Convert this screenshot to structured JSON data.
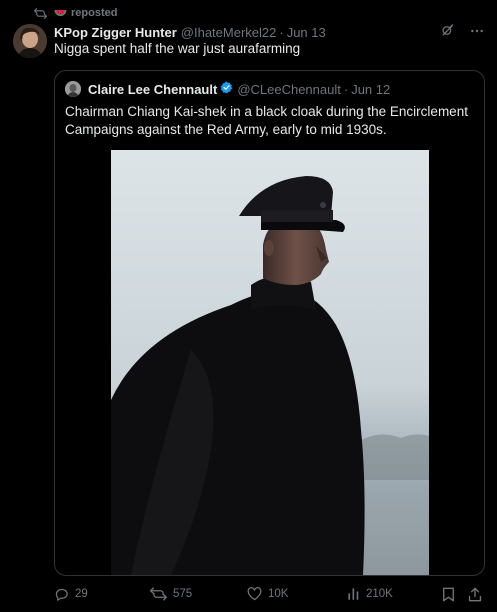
{
  "repost": {
    "label": "reposted"
  },
  "tweet": {
    "display_name": "KPop Zigger Hunter",
    "handle": "@IhateMerkel22",
    "separator": "·",
    "time": "Jun 13",
    "text": "Nigga spent half the war just aurafarming"
  },
  "quote": {
    "display_name": "Claire Lee Chennault",
    "handle": "@CLeeChennault",
    "separator": "·",
    "time": "Jun 12",
    "text": "Chairman Chiang Kai-shek in a black cloak during the Encirclement Campaigns against the Red Army, early to mid 1930s."
  },
  "actions": {
    "replies": "29",
    "reposts": "575",
    "likes": "10K",
    "views": "210K"
  },
  "colors": {
    "background": "#000000",
    "text": "#e7e9ea",
    "muted": "#71767b",
    "border": "#2f3336",
    "verified": "#1d9bf0",
    "watermelon": "#e0245e"
  },
  "icons": {
    "repost_line": "repost-icon",
    "watermelon": "watermelon-icon",
    "grok": "grok-icon",
    "more": "more-icon",
    "verified": "verified-badge-icon",
    "reply": "reply-icon",
    "repost": "repost-icon",
    "like": "heart-icon",
    "views": "views-icon",
    "bookmark": "bookmark-icon",
    "share": "share-icon"
  }
}
